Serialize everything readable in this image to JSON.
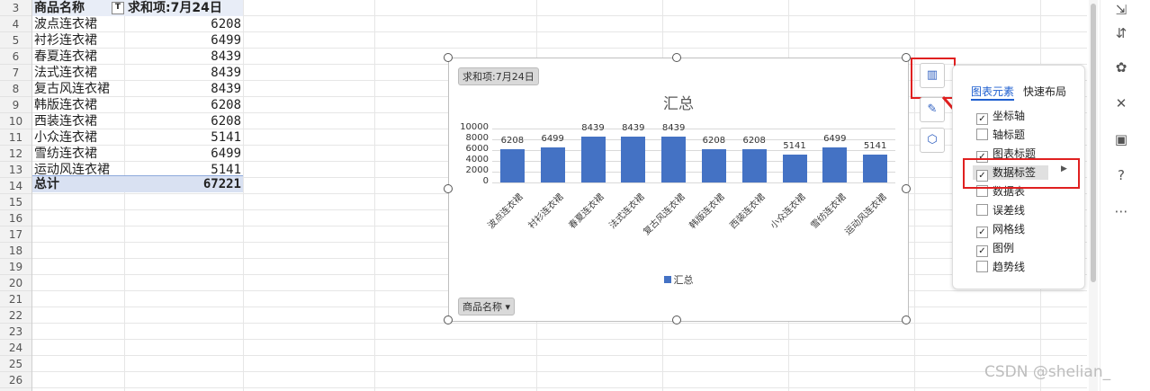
{
  "rows": [
    "3",
    "4",
    "5",
    "6",
    "7",
    "8",
    "9",
    "10",
    "11",
    "12",
    "13",
    "14",
    "15",
    "16",
    "17",
    "18",
    "19",
    "20",
    "21",
    "22",
    "23",
    "24",
    "25",
    "26"
  ],
  "pivot": {
    "header_label": "商品名称",
    "header_value": "求和项:7月24日",
    "items": [
      {
        "name": "波点连衣裙",
        "value": "6208"
      },
      {
        "name": "衬衫连衣裙",
        "value": "6499"
      },
      {
        "name": "春夏连衣裙",
        "value": "8439"
      },
      {
        "name": "法式连衣裙",
        "value": "8439"
      },
      {
        "name": "复古风连衣裙",
        "value": "8439"
      },
      {
        "name": "韩版连衣裙",
        "value": "6208"
      },
      {
        "name": "西装连衣裙",
        "value": "6208"
      },
      {
        "name": "小众连衣裙",
        "value": "5141"
      },
      {
        "name": "雪纺连衣裙",
        "value": "6499"
      },
      {
        "name": "运动风连衣裙",
        "value": "5141"
      }
    ],
    "total_label": "总计",
    "total_value": "67221"
  },
  "chart_data": {
    "type": "bar",
    "title": "汇总",
    "categories": [
      "波点连衣裙",
      "衬衫连衣裙",
      "春夏连衣裙",
      "法式连衣裙",
      "复古风连衣裙",
      "韩版连衣裙",
      "西装连衣裙",
      "小众连衣裙",
      "雪纺连衣裙",
      "运动风连衣裙"
    ],
    "series": [
      {
        "name": "汇总",
        "values": [
          6208,
          6499,
          8439,
          8439,
          8439,
          6208,
          6208,
          5141,
          6499,
          5141
        ]
      }
    ],
    "ylim": [
      0,
      10000
    ],
    "yticks": [
      "10000",
      "8000",
      "6000",
      "4000",
      "2000",
      "0"
    ],
    "data_labels": true,
    "grid": true,
    "legend": "bottom",
    "color": "#4472c4"
  },
  "chart": {
    "value_field_button": "求和项:7月24日",
    "axis_field_button": "商品名称"
  },
  "panel": {
    "tab_elements": "图表元素",
    "tab_layout": "快速布局",
    "options": [
      {
        "label": "坐标轴",
        "checked": true
      },
      {
        "label": "轴标题",
        "checked": false
      },
      {
        "label": "图表标题",
        "checked": true
      },
      {
        "label": "数据标签",
        "checked": true
      },
      {
        "label": "数据表",
        "checked": false
      },
      {
        "label": "误差线",
        "checked": false
      },
      {
        "label": "网格线",
        "checked": true
      },
      {
        "label": "图例",
        "checked": true
      },
      {
        "label": "趋势线",
        "checked": false
      }
    ]
  },
  "watermark": "CSDN @shelian_"
}
